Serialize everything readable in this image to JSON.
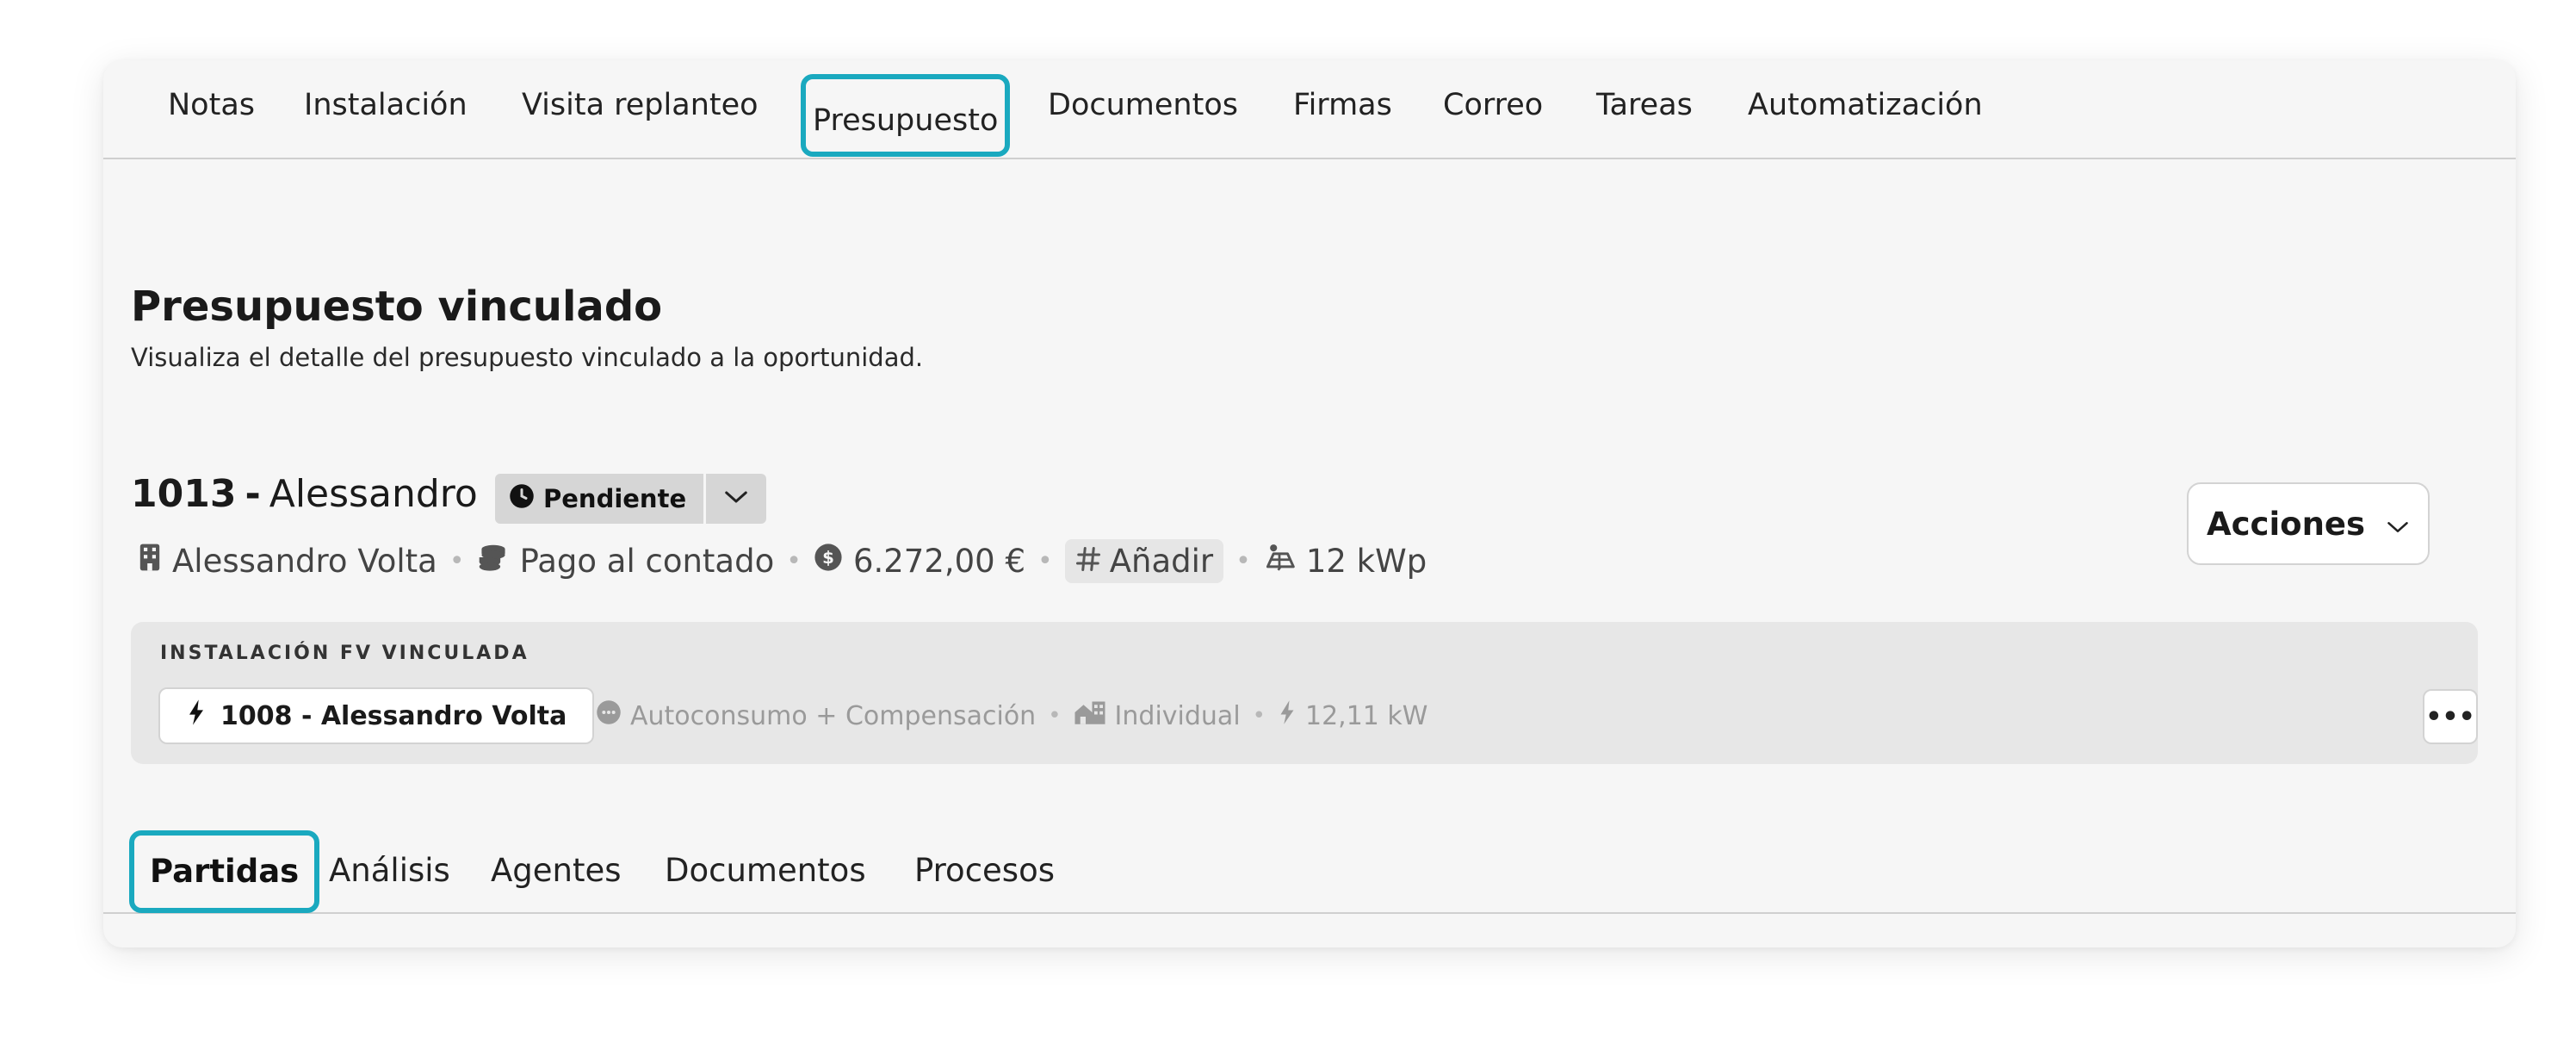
{
  "top_tabs": [
    {
      "label": "Notas"
    },
    {
      "label": "Instalación"
    },
    {
      "label": "Visita replanteo"
    },
    {
      "label": "Presupuesto"
    },
    {
      "label": "Documentos"
    },
    {
      "label": "Firmas"
    },
    {
      "label": "Correo"
    },
    {
      "label": "Tareas"
    },
    {
      "label": "Automatización"
    }
  ],
  "section": {
    "title": "Presupuesto vinculado",
    "subtitle": "Visualiza el detalle del presupuesto vinculado a la oportunidad."
  },
  "budget": {
    "number": "1013",
    "dash": "-",
    "name": "Alessandro",
    "status": "Pendiente",
    "client": "Alessandro Volta",
    "payment": "Pago al contado",
    "amount": "6.272,00 €",
    "tag_add": "Añadir",
    "power": "12 kWp",
    "actions_label": "Acciones"
  },
  "linked_install": {
    "label": "INSTALACIÓN FV VINCULADA",
    "chip": "1008 - Alessandro Volta",
    "mode": "Autoconsumo + Compensación",
    "type": "Individual",
    "power": "12,11 kW",
    "more": "•••"
  },
  "bottom_tabs": [
    {
      "label": "Partidas"
    },
    {
      "label": "Análisis"
    },
    {
      "label": "Agentes"
    },
    {
      "label": "Documentos"
    },
    {
      "label": "Procesos"
    }
  ],
  "colors": {
    "highlight": "#1aa9bf",
    "card_bg": "#f6f6f6",
    "linked_bg": "#e7e7e7"
  },
  "icons": {
    "status": "clock-icon",
    "client": "building-icon",
    "payment": "coins-icon",
    "amount": "dollar-coin-icon",
    "tag": "hash-icon",
    "power": "solar-panel-icon",
    "bolt": "bolt-icon",
    "mode": "chat-bubble-icon",
    "type": "house-building-icon"
  }
}
